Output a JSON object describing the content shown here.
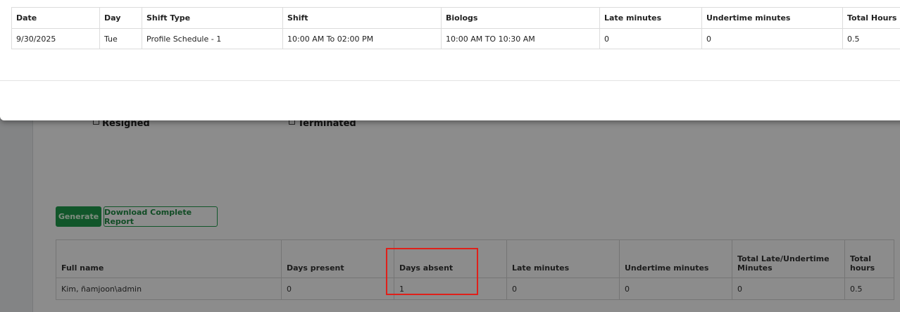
{
  "status_options": {
    "resigned": "Resigned",
    "terminated": "Terminated"
  },
  "actions": {
    "generate": "Generate",
    "download": "Download Complete Report"
  },
  "summary_table": {
    "headers": [
      "Full name",
      "Days present",
      "Days absent",
      "Late minutes",
      "Undertime minutes",
      "Total Late/Undertime Minutes",
      "Total hours"
    ],
    "rows": [
      [
        "Kim, ñamjoon\\admin",
        "0",
        "1",
        "0",
        "0",
        "0",
        "0.5"
      ]
    ]
  },
  "detail_table": {
    "headers": [
      "Date",
      "Day",
      "Shift Type",
      "Shift",
      "Biologs",
      "Late minutes",
      "Undertime minutes",
      "Total Hours"
    ],
    "rows": [
      [
        "9/30/2025",
        "Tue",
        "Profile Schedule - 1",
        "10:00 AM To 02:00 PM",
        "10:00 AM TO 10:30 AM",
        "0",
        "0",
        "0.5"
      ]
    ]
  },
  "colors": {
    "accent_green": "#1f9d4d",
    "highlight_red": "#e0201a"
  }
}
